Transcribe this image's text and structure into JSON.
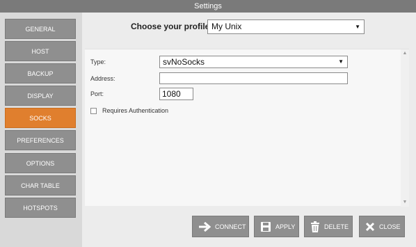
{
  "window": {
    "title": "Settings"
  },
  "sidebar": {
    "items": [
      {
        "label": "GENERAL"
      },
      {
        "label": "HOST"
      },
      {
        "label": "BACKUP"
      },
      {
        "label": "DISPLAY"
      },
      {
        "label": "SOCKS",
        "active": true
      },
      {
        "label": "PREFERENCES"
      },
      {
        "label": "OPTIONS"
      },
      {
        "label": "CHAR TABLE"
      },
      {
        "label": "HOTSPOTS"
      }
    ]
  },
  "profile": {
    "label": "Choose your profile:",
    "value": "My Unix"
  },
  "socks": {
    "type_label": "Type:",
    "type_value": "svNoSocks",
    "address_label": "Address:",
    "address_value": "",
    "port_label": "Port:",
    "port_value": "1080",
    "requires_auth_label": "Requires Authentication",
    "requires_auth_checked": false
  },
  "actions": {
    "connect": "CONNECT",
    "apply": "APPLY",
    "delete": "DELETE",
    "close": "CLOSE"
  },
  "colors": {
    "active": "#e07f2e",
    "button": "#8f8f8f",
    "titlebar": "#7a7a7a"
  }
}
